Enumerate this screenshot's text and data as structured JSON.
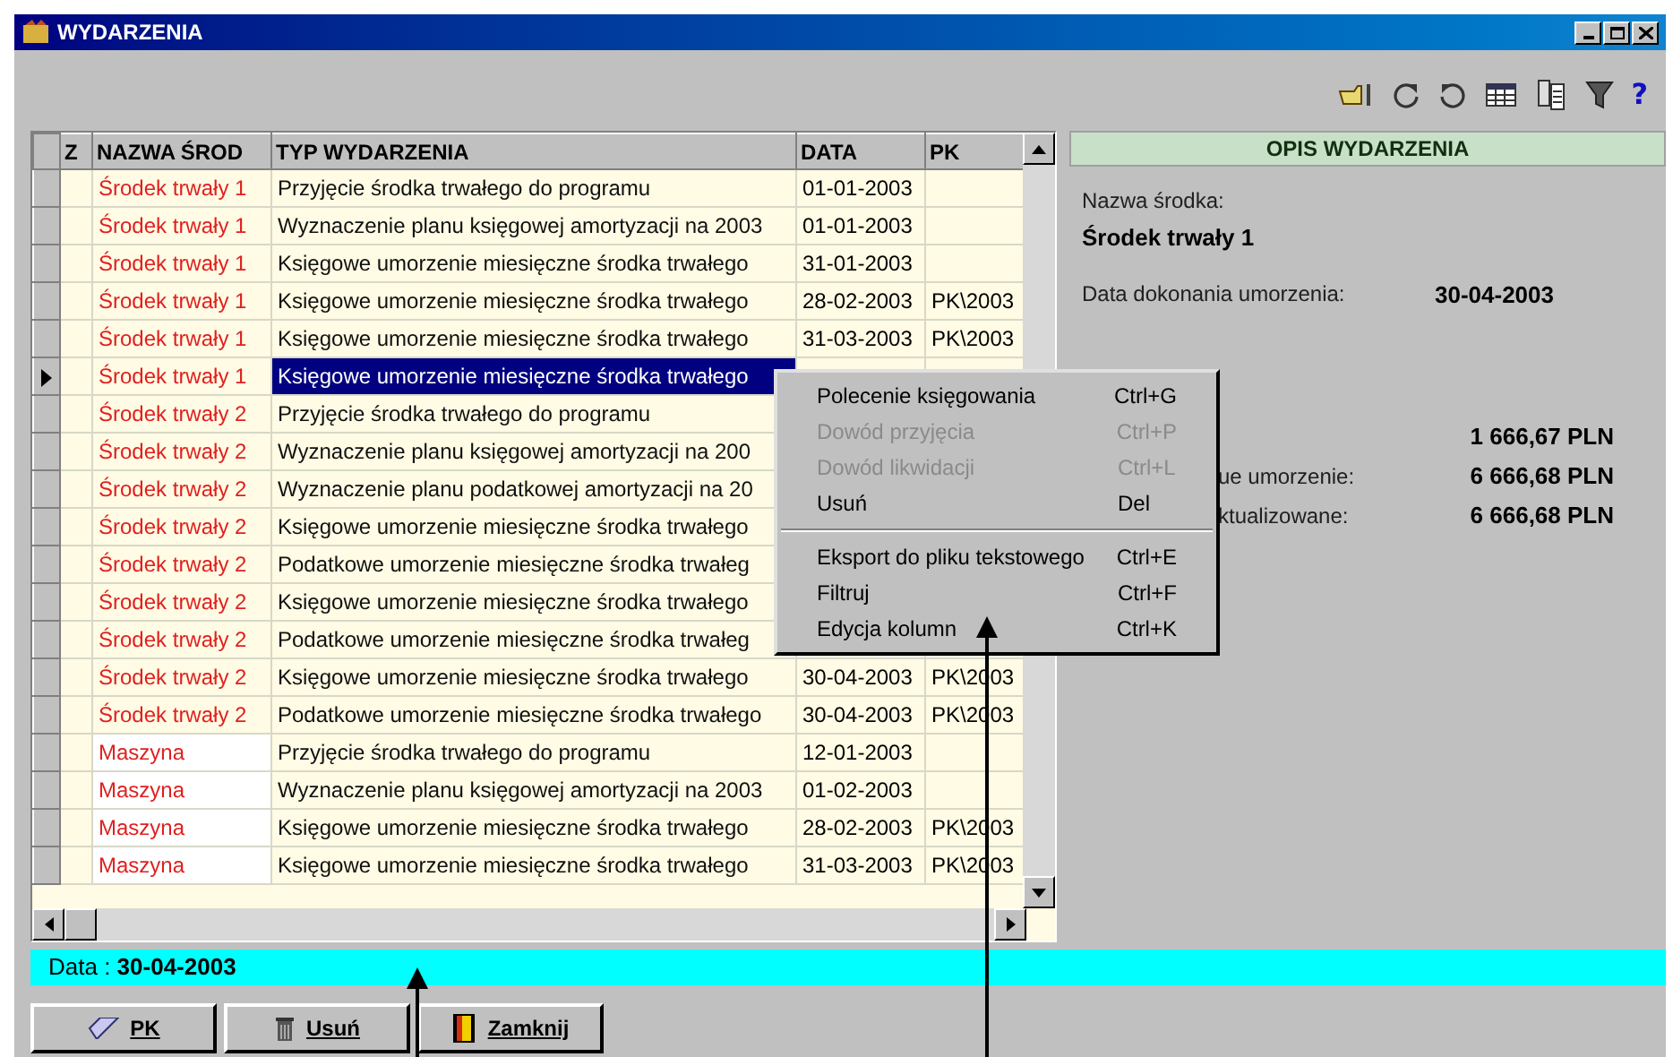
{
  "window": {
    "title": "WYDARZENIA"
  },
  "toolbar": {
    "help": "?"
  },
  "table": {
    "columns": [
      "Z",
      "NAZWA ŚROD",
      "TYP WYDARZENIA",
      "DATA",
      "PK"
    ],
    "rows": [
      {
        "name": "Środek trwały 1",
        "type": "Przyjęcie środka trwałego do programu",
        "date": "01-01-2003",
        "pk": "",
        "selected": false
      },
      {
        "name": "Środek trwały 1",
        "type": "Wyznaczenie planu księgowej amortyzacji na 2003",
        "date": "01-01-2003",
        "pk": "",
        "selected": false
      },
      {
        "name": "Środek trwały 1",
        "type": "Księgowe umorzenie miesięczne środka trwałego",
        "date": "31-01-2003",
        "pk": "",
        "selected": false
      },
      {
        "name": "Środek trwały 1",
        "type": "Księgowe umorzenie miesięczne środka trwałego",
        "date": "28-02-2003",
        "pk": "PK\\2003",
        "selected": false
      },
      {
        "name": "Środek trwały 1",
        "type": "Księgowe umorzenie miesięczne środka trwałego",
        "date": "31-03-2003",
        "pk": "PK\\2003",
        "selected": false
      },
      {
        "name": "Środek trwały 1",
        "type": "Księgowe umorzenie miesięczne środka trwałego",
        "date": "",
        "pk": "",
        "selected": true
      },
      {
        "name": "Środek trwały 2",
        "type": "Przyjęcie środka trwałego do programu",
        "date": "",
        "pk": "",
        "selected": false
      },
      {
        "name": "Środek trwały 2",
        "type": "Wyznaczenie planu księgowej amortyzacji na 200",
        "date": "",
        "pk": "",
        "selected": false
      },
      {
        "name": "Środek trwały 2",
        "type": "Wyznaczenie planu podatkowej amortyzacji na 20",
        "date": "",
        "pk": "",
        "selected": false
      },
      {
        "name": "Środek trwały 2",
        "type": "Księgowe umorzenie miesięczne środka trwałego",
        "date": "",
        "pk": "",
        "selected": false
      },
      {
        "name": "Środek trwały 2",
        "type": "Podatkowe umorzenie miesięczne środka trwałeg",
        "date": "",
        "pk": "",
        "selected": false
      },
      {
        "name": "Środek trwały 2",
        "type": "Księgowe umorzenie miesięczne środka trwałego",
        "date": "",
        "pk": "",
        "selected": false
      },
      {
        "name": "Środek trwały 2",
        "type": "Podatkowe umorzenie miesięczne środka trwałeg",
        "date": "",
        "pk": "",
        "selected": false
      },
      {
        "name": "Środek trwały 2",
        "type": "Księgowe umorzenie miesięczne środka trwałego",
        "date": "30-04-2003",
        "pk": "PK\\2003",
        "selected": false
      },
      {
        "name": "Środek trwały 2",
        "type": "Podatkowe umorzenie miesięczne środka trwałego",
        "date": "30-04-2003",
        "pk": "PK\\2003",
        "selected": false
      },
      {
        "name": "Maszyna",
        "type": "Przyjęcie środka trwałego do programu",
        "date": "12-01-2003",
        "pk": "",
        "selected": false
      },
      {
        "name": "Maszyna",
        "type": "Wyznaczenie planu księgowej amortyzacji na 2003",
        "date": "01-02-2003",
        "pk": "",
        "selected": false
      },
      {
        "name": "Maszyna",
        "type": "Księgowe umorzenie miesięczne środka trwałego",
        "date": "28-02-2003",
        "pk": "PK\\2003",
        "selected": false
      },
      {
        "name": "Maszyna",
        "type": "Księgowe umorzenie miesięczne środka trwałego",
        "date": "31-03-2003",
        "pk": "PK\\2003",
        "selected": false
      }
    ]
  },
  "details": {
    "title": "OPIS WYDARZENIA",
    "name_label": "Nazwa środka:",
    "name_value": "Środek trwały 1",
    "date_label": "Data dokonania umorzenia:",
    "date_value": "30-04-2003",
    "amounts": [
      {
        "value": "1 666,67 PLN"
      },
      {
        "label": "ue umorzenie:",
        "value": "6 666,68 PLN"
      },
      {
        "label": "ktualizowane:",
        "value": "6 666,68 PLN"
      }
    ]
  },
  "context_menu": [
    {
      "kind": "item",
      "label": "Polecenie księgowania",
      "shortcut": "Ctrl+G",
      "disabled": false
    },
    {
      "kind": "item",
      "label": "Dowód przyjęcia",
      "shortcut": "Ctrl+P",
      "disabled": true
    },
    {
      "kind": "item",
      "label": "Dowód likwidacji",
      "shortcut": "Ctrl+L",
      "disabled": true
    },
    {
      "kind": "item",
      "label": "Usuń",
      "shortcut": "Del",
      "disabled": false
    },
    {
      "kind": "separator"
    },
    {
      "kind": "item",
      "label": "Eksport do pliku tekstowego",
      "shortcut": "Ctrl+E",
      "disabled": false
    },
    {
      "kind": "item",
      "label": "Filtruj",
      "shortcut": "Ctrl+F",
      "disabled": false
    },
    {
      "kind": "item",
      "label": "Edycja kolumn",
      "shortcut": "Ctrl+K",
      "disabled": false
    }
  ],
  "status_bar": "Data : **30-04-2003**",
  "buttons": [
    {
      "kind": "pk",
      "label": "PK"
    },
    {
      "kind": "delete",
      "label": "Usuń"
    },
    {
      "kind": "close",
      "label": "Zamknij"
    }
  ]
}
